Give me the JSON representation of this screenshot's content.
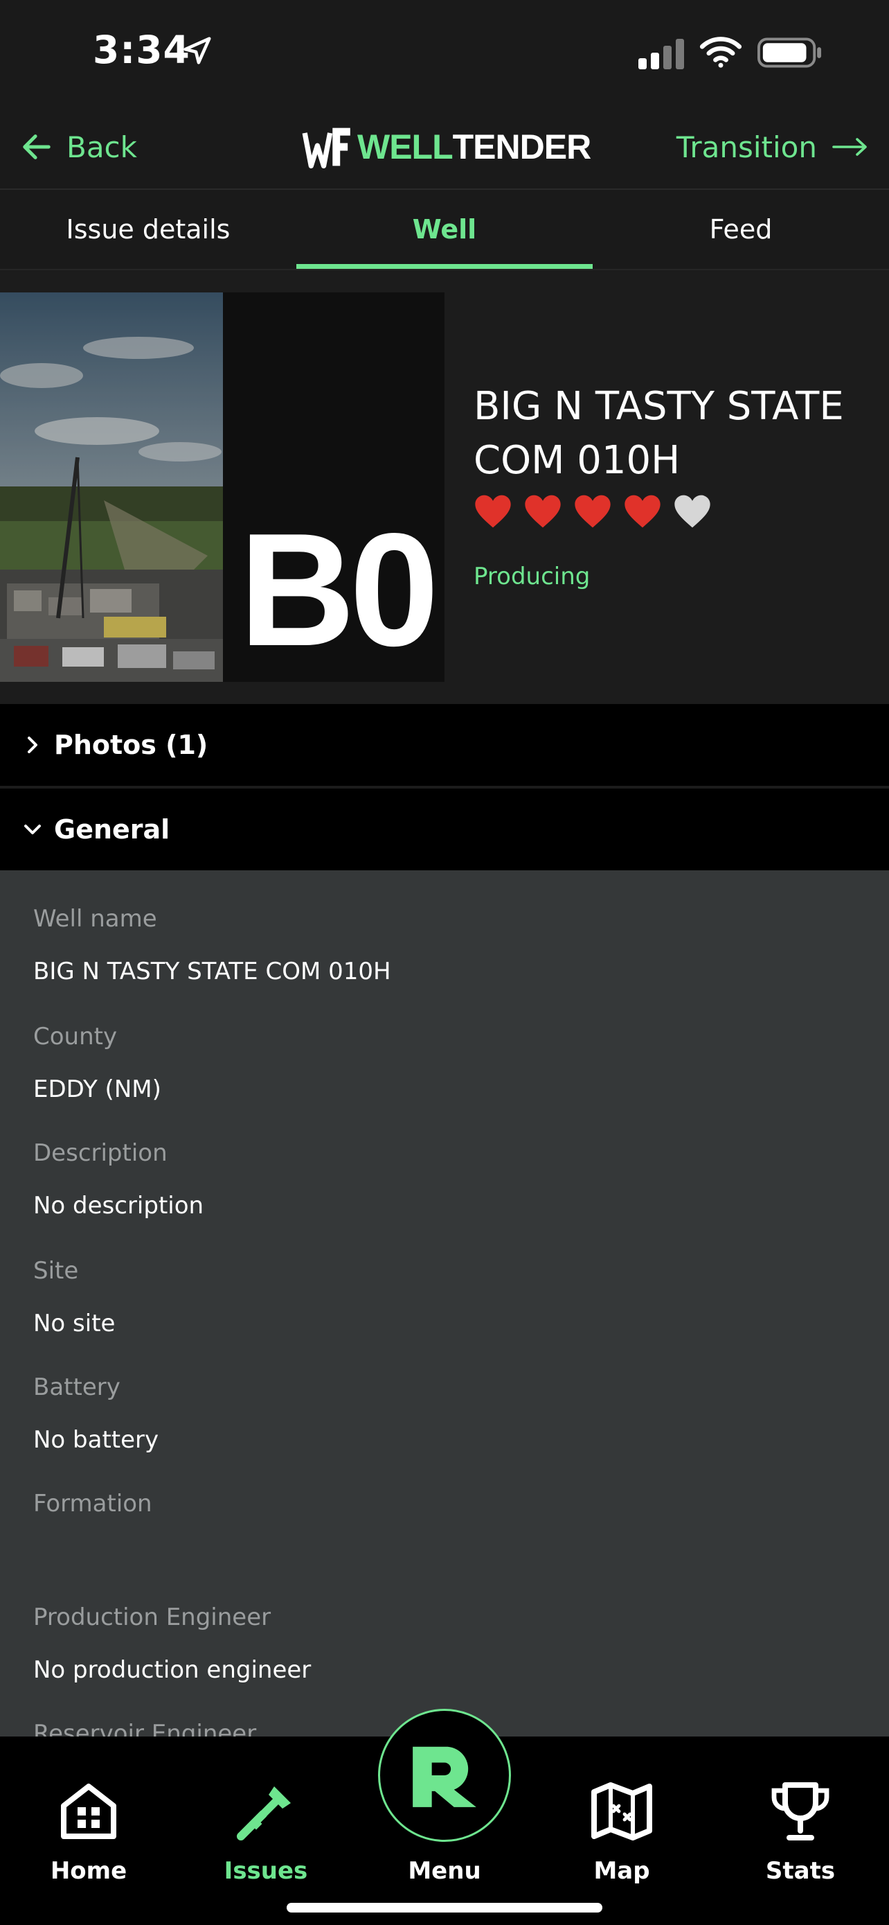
{
  "status_bar": {
    "time": "3:34"
  },
  "header": {
    "back_label": "Back",
    "logo_part1": "WELL",
    "logo_part2": "TENDER",
    "transition_label": "Transition"
  },
  "tabs": [
    {
      "label": "Issue details",
      "active": false
    },
    {
      "label": "Well",
      "active": true
    },
    {
      "label": "Feed",
      "active": false
    }
  ],
  "hero": {
    "badge": "B0",
    "title": "BIG N TASTY STATE COM 010H",
    "rating": {
      "filled": 4,
      "total": 5
    },
    "status": "Producing"
  },
  "sections": {
    "photos_label": "Photos (1)",
    "general_label": "General"
  },
  "general": {
    "fields": [
      {
        "label": "Well name",
        "value": "BIG N TASTY STATE COM 010H"
      },
      {
        "label": "County",
        "value": "EDDY (NM)"
      },
      {
        "label": "Description",
        "value": "No description"
      },
      {
        "label": "Site",
        "value": "No site"
      },
      {
        "label": "Battery",
        "value": "No battery"
      },
      {
        "label": "Formation",
        "value": ""
      },
      {
        "label": "Production Engineer",
        "value": "No production engineer"
      },
      {
        "label": "Reservoir Engineer",
        "value": ""
      }
    ]
  },
  "nav": {
    "home": "Home",
    "issues": "Issues",
    "menu": "Menu",
    "map": "Map",
    "stats": "Stats"
  },
  "colors": {
    "accent": "#6ee58f",
    "header_bg": "#1a1a1a",
    "details_bg": "#353839",
    "heart_red": "#e0322a",
    "heart_gray": "#d6d6d6"
  }
}
